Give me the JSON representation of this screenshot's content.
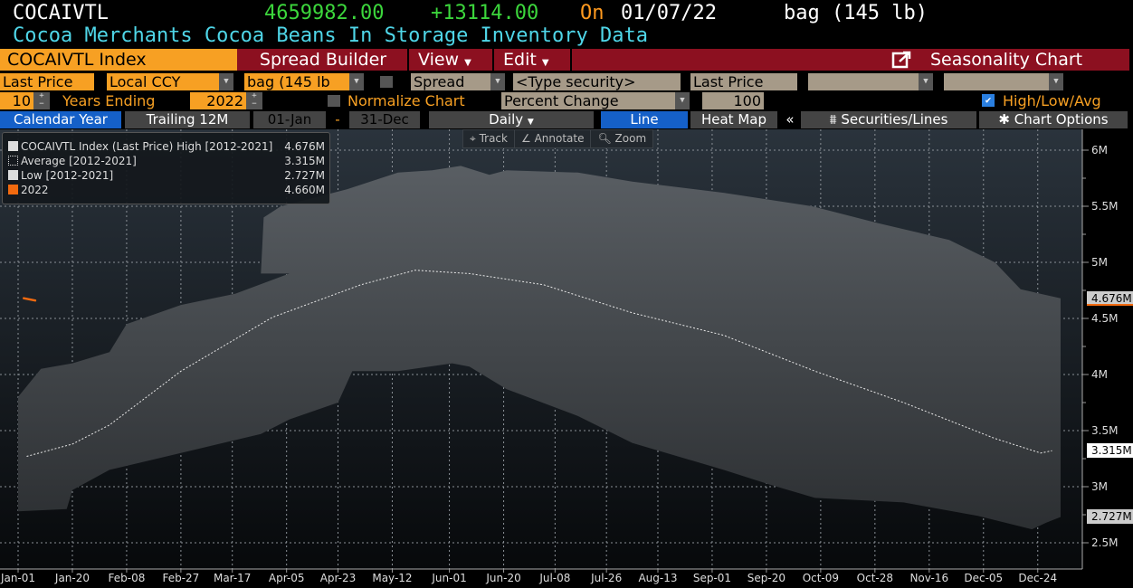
{
  "header": {
    "ticker": "COCAIVTL",
    "price": "4659982.00",
    "change": "+13114.00",
    "on_label": "On",
    "date": "01/07/22",
    "unit": "bag (145 lb)",
    "description": "Cocoa Merchants Cocoa Beans In Storage Inventory Data"
  },
  "menu": {
    "security": "COCAIVTL Index",
    "spread_builder": "Spread Builder",
    "view": "View",
    "edit": "Edit",
    "title": "Seasonality Chart"
  },
  "row1": {
    "field": "Last Price",
    "currency": "Local CCY",
    "unit": "bag (145 lb",
    "spread": "Spread",
    "type_security": "<Type security>",
    "field2": "Last Price"
  },
  "row2": {
    "years": "10",
    "years_ending_label": "Years Ending",
    "year": "2022",
    "normalize_label": "Normalize Chart",
    "normalize_mode": "Percent Change",
    "base": "100",
    "hla_label": "High/Low/Avg"
  },
  "row3": {
    "calendar_year": "Calendar Year",
    "trailing": "Trailing 12M",
    "start": "01-Jan",
    "dash": "-",
    "end": "31-Dec",
    "frequency": "Daily",
    "line": "Line",
    "heat_map": "Heat Map",
    "collapse": "«",
    "securities": "Securities/Lines",
    "chart_options": "Chart Options"
  },
  "tools": {
    "track": "Track",
    "annotate": "Annotate",
    "zoom": "Zoom"
  },
  "colors": {
    "accent": "#f7a023",
    "menu": "#8c1020",
    "price": "#3cd63c",
    "cyan": "#4fd6e8",
    "series_2022": "#f26a0f"
  },
  "chart_data": {
    "type": "area",
    "title": "Seasonality Chart",
    "legend": [
      {
        "label": "COCAIVTL Index (Last Price) High [2012-2021]",
        "value": "4.676M"
      },
      {
        "label": "Average  [2012-2021]",
        "value": "3.315M"
      },
      {
        "label": "Low  [2012-2021]",
        "value": "2.727M"
      },
      {
        "label": "2022",
        "value": "4.660M"
      }
    ],
    "legend_placement": "top-left",
    "ylim": [
      2.35,
      6.1
    ],
    "y_unit": "M",
    "y_ticks": [
      {
        "v": 2.5,
        "label": "2.5M"
      },
      {
        "v": 3,
        "label": "3M"
      },
      {
        "v": 3.5,
        "label": "3.5M"
      },
      {
        "v": 4,
        "label": "4M"
      },
      {
        "v": 4.5,
        "label": "4.5M"
      },
      {
        "v": 5,
        "label": "5M"
      },
      {
        "v": 5.5,
        "label": "5.5M"
      },
      {
        "v": 6,
        "label": "6M"
      }
    ],
    "x_ticks": [
      {
        "d": 0,
        "label": "Jan-01"
      },
      {
        "d": 19,
        "label": "Jan-20"
      },
      {
        "d": 38,
        "label": "Feb-08"
      },
      {
        "d": 57,
        "label": "Feb-27"
      },
      {
        "d": 75,
        "label": "Mar-17"
      },
      {
        "d": 94,
        "label": "Apr-05"
      },
      {
        "d": 112,
        "label": "Apr-23"
      },
      {
        "d": 131,
        "label": "May-12"
      },
      {
        "d": 151,
        "label": "Jun-01"
      },
      {
        "d": 170,
        "label": "Jun-20"
      },
      {
        "d": 188,
        "label": "Jul-08"
      },
      {
        "d": 206,
        "label": "Jul-26"
      },
      {
        "d": 224,
        "label": "Aug-13"
      },
      {
        "d": 243,
        "label": "Sep-01"
      },
      {
        "d": 262,
        "label": "Sep-20"
      },
      {
        "d": 281,
        "label": "Oct-09"
      },
      {
        "d": 300,
        "label": "Oct-28"
      },
      {
        "d": 319,
        "label": "Nov-16"
      },
      {
        "d": 338,
        "label": "Dec-05"
      },
      {
        "d": 357,
        "label": "Dec-24"
      }
    ],
    "x_max": 365,
    "high": [
      [
        0,
        3.8
      ],
      [
        8,
        4.05
      ],
      [
        19,
        4.1
      ],
      [
        32,
        4.2
      ],
      [
        38,
        4.45
      ],
      [
        57,
        4.62
      ],
      [
        76,
        4.72
      ],
      [
        95,
        4.9
      ],
      [
        85,
        4.9
      ],
      [
        86,
        5.4
      ],
      [
        92,
        5.5
      ],
      [
        115,
        5.65
      ],
      [
        133,
        5.8
      ],
      [
        145,
        5.82
      ],
      [
        155,
        5.86
      ],
      [
        165,
        5.78
      ],
      [
        171,
        5.82
      ],
      [
        196,
        5.8
      ],
      [
        215,
        5.72
      ],
      [
        247,
        5.62
      ],
      [
        278,
        5.5
      ],
      [
        301,
        5.35
      ],
      [
        326,
        5.2
      ],
      [
        342,
        5.0
      ],
      [
        351,
        4.76
      ],
      [
        365,
        4.68
      ]
    ],
    "avg": [
      [
        3,
        3.27
      ],
      [
        19,
        3.38
      ],
      [
        32,
        3.55
      ],
      [
        57,
        4.03
      ],
      [
        89,
        4.51
      ],
      [
        120,
        4.8
      ],
      [
        139,
        4.93
      ],
      [
        158,
        4.9
      ],
      [
        184,
        4.8
      ],
      [
        215,
        4.55
      ],
      [
        247,
        4.35
      ],
      [
        279,
        4.03
      ],
      [
        310,
        3.75
      ],
      [
        342,
        3.43
      ],
      [
        358,
        3.3
      ],
      [
        362,
        3.32
      ]
    ],
    "low": [
      [
        0,
        2.78
      ],
      [
        17,
        2.8
      ],
      [
        19,
        2.97
      ],
      [
        32,
        3.15
      ],
      [
        57,
        3.3
      ],
      [
        85,
        3.47
      ],
      [
        95,
        3.6
      ],
      [
        112,
        3.75
      ],
      [
        117,
        4.03
      ],
      [
        133,
        4.03
      ],
      [
        152,
        4.1
      ],
      [
        158,
        4.07
      ],
      [
        171,
        3.87
      ],
      [
        196,
        3.63
      ],
      [
        215,
        3.39
      ],
      [
        247,
        3.15
      ],
      [
        263,
        3.02
      ],
      [
        279,
        2.9
      ],
      [
        310,
        2.86
      ],
      [
        336,
        2.74
      ],
      [
        355,
        2.62
      ],
      [
        360,
        2.68
      ],
      [
        365,
        2.73
      ]
    ],
    "series_2022": [
      [
        2,
        4.68
      ],
      [
        6,
        4.66
      ]
    ],
    "badges": {
      "high": "4.676M",
      "avg": "3.315M",
      "low": "2.727M"
    }
  }
}
